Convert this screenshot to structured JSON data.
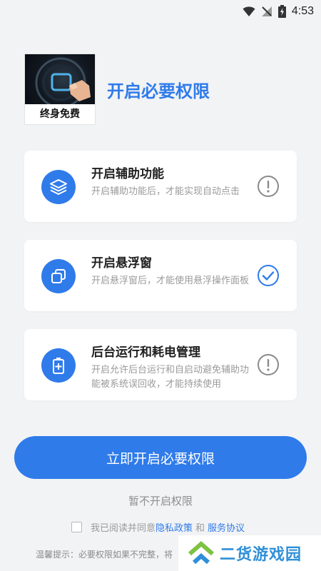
{
  "status_bar": {
    "time": "4:53"
  },
  "header": {
    "logo_caption": "终身免费",
    "title": "开启必要权限"
  },
  "permissions": [
    {
      "title": "开启辅助功能",
      "description": "开启辅助功能后，才能实现自动点击",
      "icon": "layers-icon",
      "status": "warning"
    },
    {
      "title": "开启悬浮窗",
      "description": "开启悬浮窗后，才能使用悬浮操作面板",
      "icon": "floating-window-icon",
      "status": "granted"
    },
    {
      "title": "后台运行和耗电管理",
      "description": "开启允许后台运行和自启动避免辅助功能被系统误回收，才能持续使用",
      "icon": "battery-icon",
      "status": "warning"
    }
  ],
  "actions": {
    "primary_label": "立即开启必要权限",
    "skip_label": "暂不开启权限"
  },
  "agreement": {
    "prefix": "我已阅读并同意",
    "privacy_link": "隐私政策",
    "and": "和",
    "service_link": "服务协议"
  },
  "tip_text": "温馨提示：必要权限如果不完整，将",
  "watermark": {
    "text": "二货游戏园"
  },
  "colors": {
    "accent": "#2f7bea",
    "background": "#f2f3f5",
    "muted": "#9a9a9a"
  }
}
